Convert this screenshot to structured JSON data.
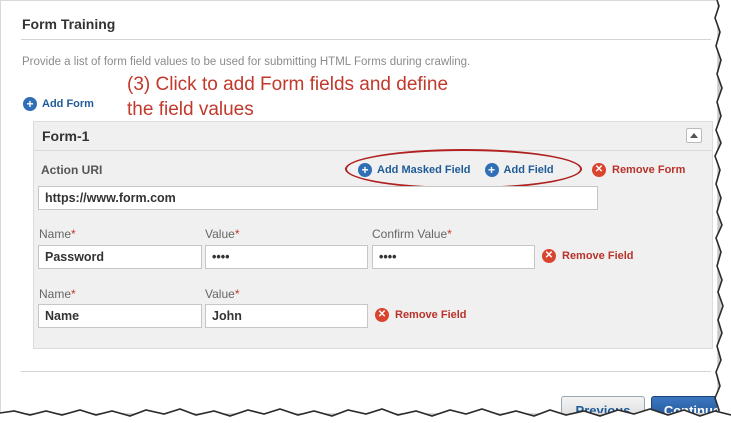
{
  "section": {
    "title": "Form Training",
    "description": "Provide a list of form field values to be used for submitting HTML Forms during crawling."
  },
  "annotation": {
    "line1": "(3) Click to add Form fields and define",
    "line2": "the field values"
  },
  "add_form_label": "Add Form",
  "form": {
    "title": "Form-1",
    "action_uri_label": "Action URI",
    "action_uri_value": "https://www.form.com",
    "add_masked_field_label": "Add Masked Field",
    "add_field_label": "Add Field",
    "remove_form_label": "Remove Form",
    "fields": [
      {
        "name_label": "Name",
        "value_label": "Value",
        "confirm_label": "Confirm Value",
        "name_value": "Password",
        "value_value": "••••",
        "confirm_value": "••••",
        "remove_label": "Remove Field"
      },
      {
        "name_label": "Name",
        "value_label": "Value",
        "name_value": "Name",
        "value_value": "John",
        "remove_label": "Remove Field"
      }
    ]
  },
  "footer": {
    "previous_label": "Previous",
    "continue_label": "Continue"
  },
  "colors": {
    "accent": "#2f6fb5",
    "danger": "#d9442f",
    "annotation": "#c0392b"
  }
}
